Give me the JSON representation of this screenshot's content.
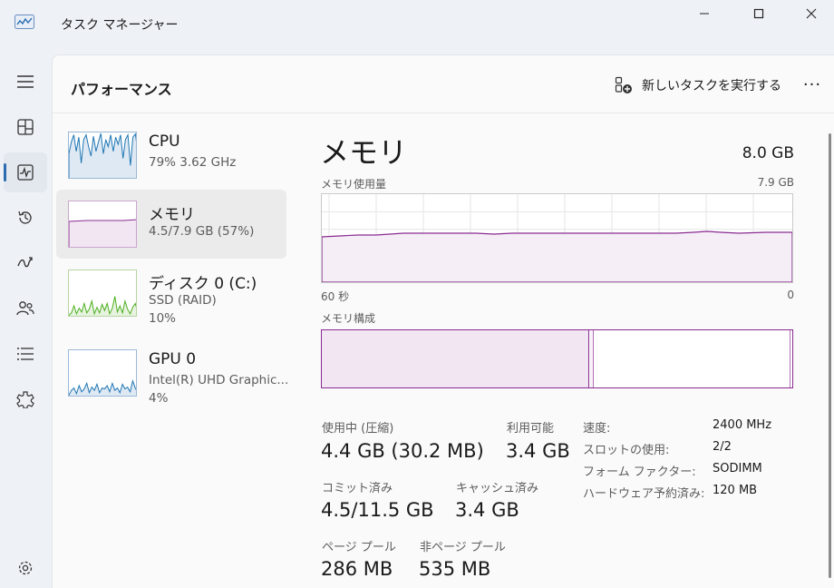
{
  "window": {
    "title": "タスク マネージャー",
    "minimize_label": "—",
    "maximize_label": "□",
    "close_label": "✕"
  },
  "nav": {
    "items": [
      {
        "name": "hamburger-menu-icon"
      },
      {
        "name": "processes-icon"
      },
      {
        "name": "performance-icon"
      },
      {
        "name": "app-history-icon"
      },
      {
        "name": "startup-apps-icon"
      },
      {
        "name": "users-icon"
      },
      {
        "name": "details-icon"
      },
      {
        "name": "services-icon"
      },
      {
        "name": "settings-icon"
      }
    ]
  },
  "header": {
    "title": "パフォーマンス",
    "run_task_label": "新しいタスクを実行する",
    "more_label": "···"
  },
  "resources": [
    {
      "name": "CPU",
      "line1": "79% 3.62 GHz",
      "line2": ""
    },
    {
      "name": "メモリ",
      "line1": "4.5/7.9 GB (57%)",
      "line2": ""
    },
    {
      "name": "ディスク 0 (C:)",
      "line1": "SSD (RAID)",
      "line2": "10%"
    },
    {
      "name": "GPU 0",
      "line1": "Intel(R) UHD Graphic...",
      "line2": "4%"
    }
  ],
  "detail": {
    "title": "メモリ",
    "total": "8.0 GB",
    "usage_label": "メモリ使用量",
    "usage_max": "7.9 GB",
    "axis_left": "60 秒",
    "axis_right": "0",
    "composition_label": "メモリ構成",
    "composition_used_fraction": 0.57,
    "stats": {
      "in_use_label": "使用中 (圧縮)",
      "in_use_value": "4.4 GB (30.2 MB)",
      "available_label": "利用可能",
      "available_value": "3.4 GB",
      "committed_label": "コミット済み",
      "committed_value": "4.5/11.5 GB",
      "cached_label": "キャッシュ済み",
      "cached_value": "3.4 GB",
      "paged_label": "ページ プール",
      "paged_value": "286 MB",
      "nonpaged_label": "非ページ プール",
      "nonpaged_value": "535 MB"
    },
    "props": [
      {
        "label": "速度:",
        "value": "2400 MHz"
      },
      {
        "label": "スロットの使用:",
        "value": "2/2"
      },
      {
        "label": "フォーム ファクター:",
        "value": "SODIMM"
      },
      {
        "label": "ハードウェア予約済み:",
        "value": "120 MB"
      }
    ]
  },
  "colors": {
    "cpu": "#1f77b4",
    "memory": "#8a2c92",
    "disk": "#4caf1f",
    "gpu": "#1f77b4",
    "accent": "#2b6cb0"
  }
}
